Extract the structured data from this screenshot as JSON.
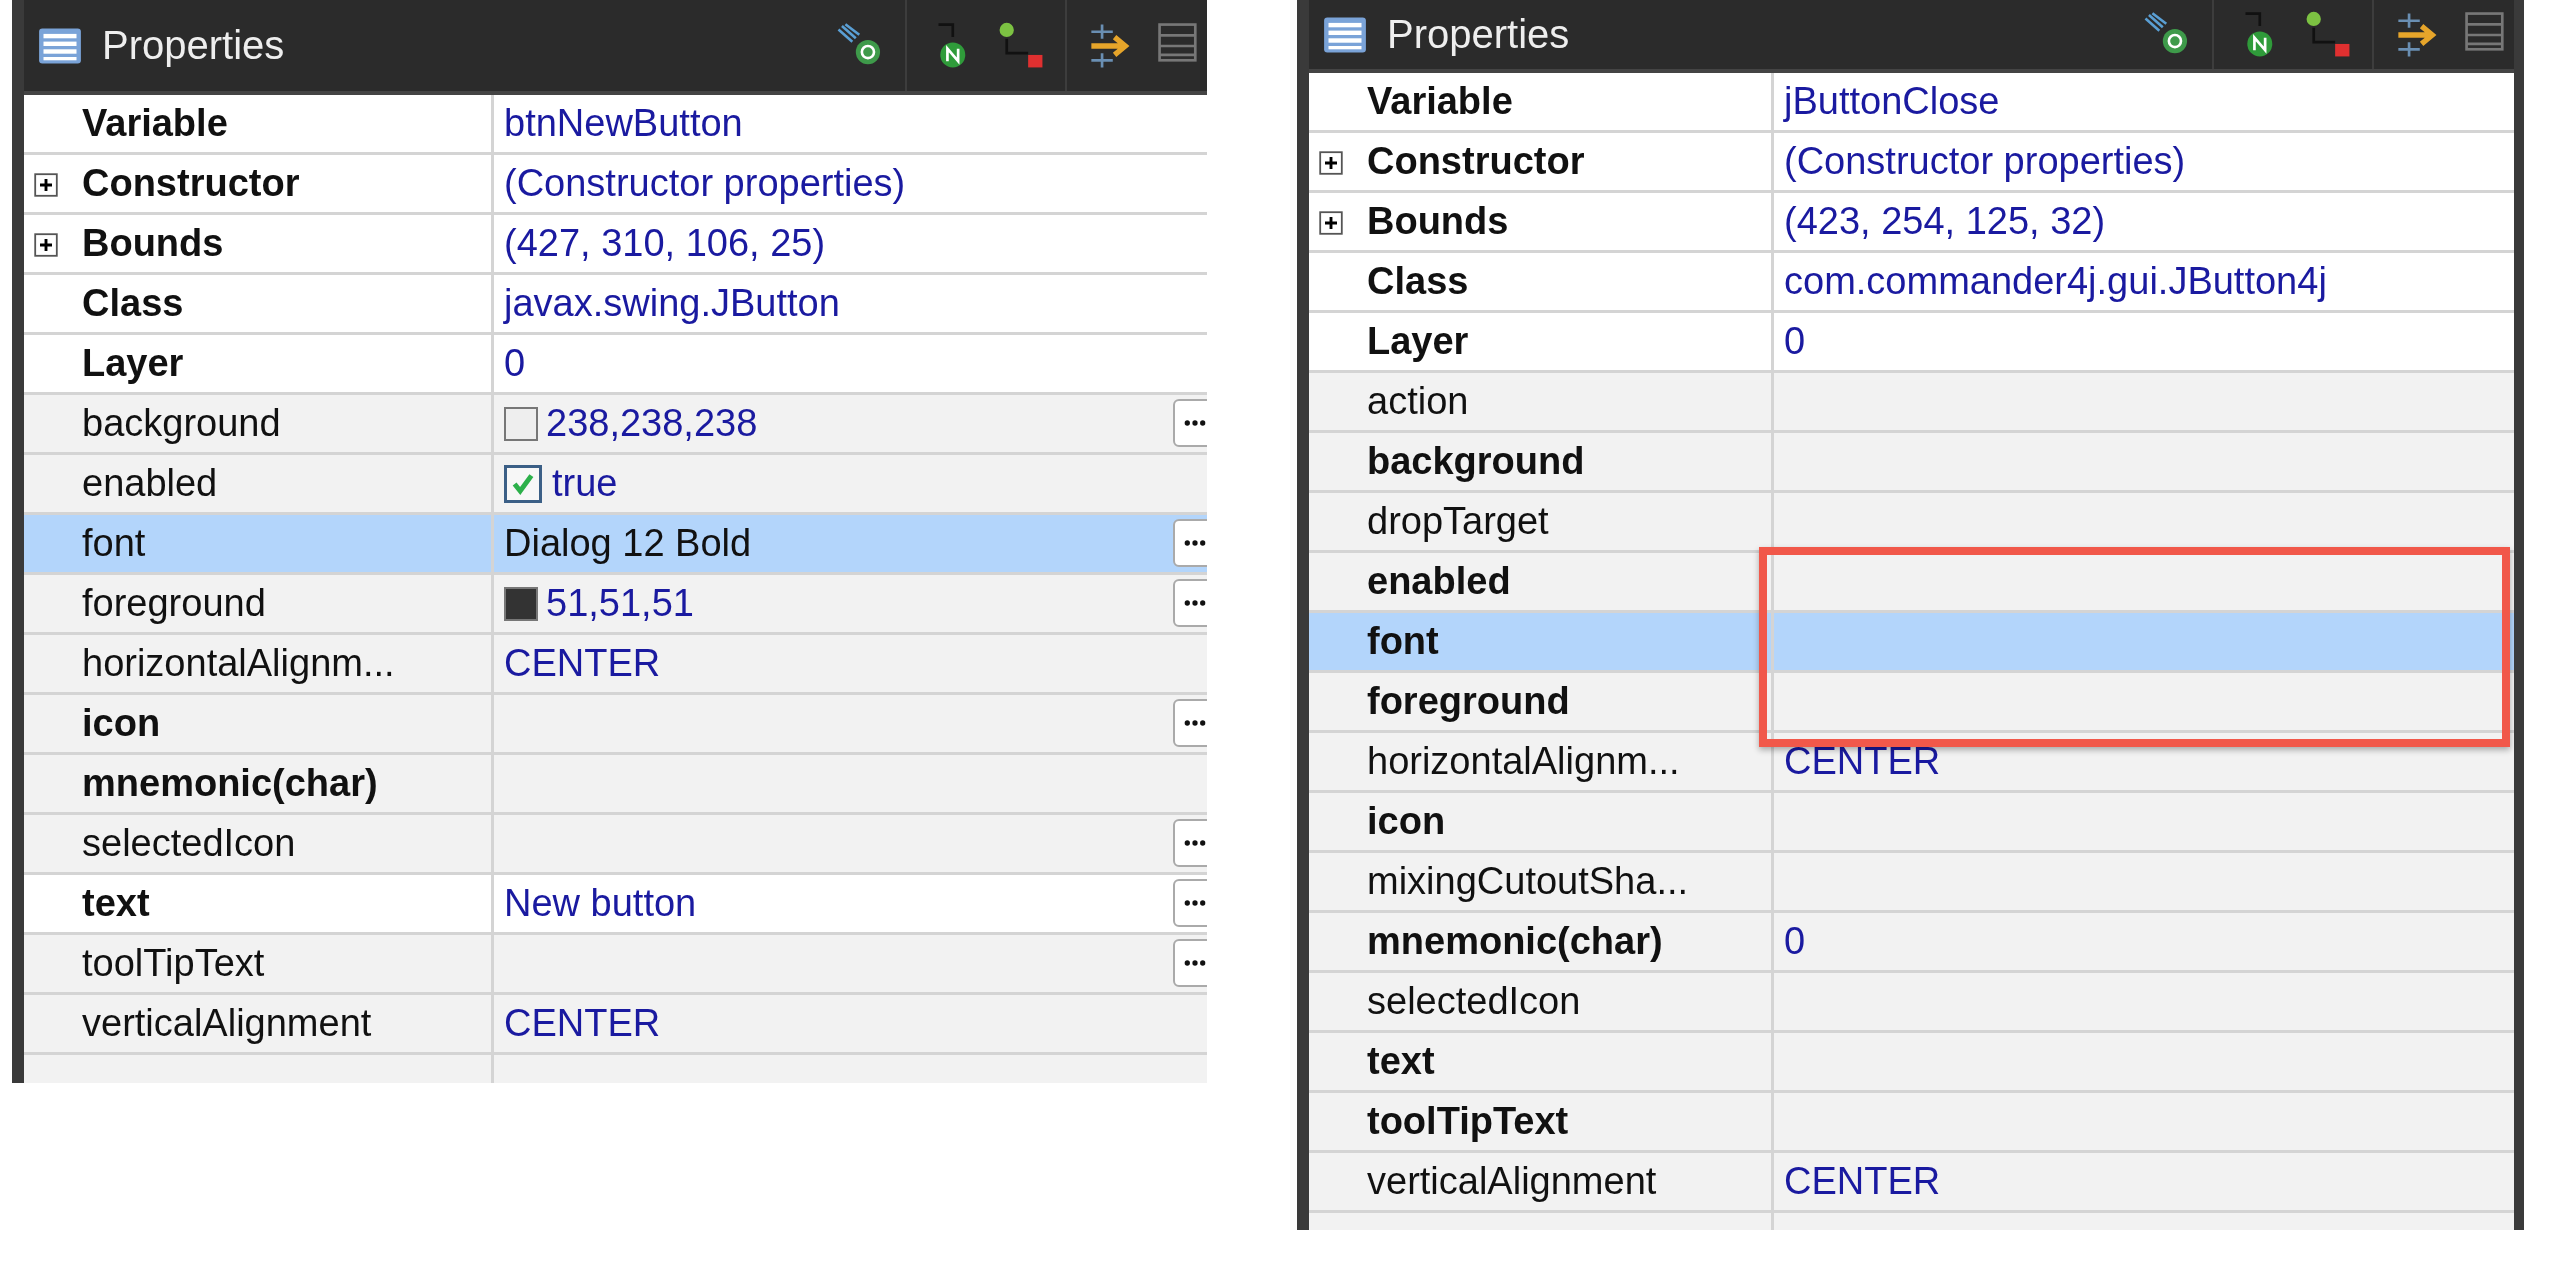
{
  "panels": [
    {
      "title": "Properties",
      "rows": [
        {
          "name": "Variable",
          "bold": true,
          "expandable": false,
          "value": "btnNewButton",
          "kind": "text",
          "has_button": false,
          "selected": false,
          "set": true,
          "boxed": false
        },
        {
          "name": "Constructor",
          "bold": true,
          "expandable": true,
          "value": "(Constructor properties)",
          "kind": "text",
          "has_button": false,
          "selected": false,
          "set": true,
          "boxed": false
        },
        {
          "name": "Bounds",
          "bold": true,
          "expandable": true,
          "value": "(427, 310, 106, 25)",
          "kind": "text",
          "has_button": false,
          "selected": false,
          "set": true,
          "boxed": false
        },
        {
          "name": "Class",
          "bold": true,
          "expandable": false,
          "value": "javax.swing.JButton",
          "kind": "text",
          "has_button": false,
          "selected": false,
          "set": true,
          "boxed": false
        },
        {
          "name": "Layer",
          "bold": true,
          "expandable": false,
          "value": "0",
          "kind": "text",
          "has_button": false,
          "selected": false,
          "set": true,
          "boxed": false
        },
        {
          "name": "background",
          "bold": false,
          "expandable": false,
          "value": "238,238,238",
          "kind": "swatch",
          "color": "#eeeeee",
          "has_button": true,
          "selected": false,
          "set": false,
          "boxed": false
        },
        {
          "name": "enabled",
          "bold": false,
          "expandable": false,
          "value": "true",
          "kind": "checkbox",
          "checked": true,
          "has_button": false,
          "selected": false,
          "set": false,
          "boxed": false
        },
        {
          "name": "font",
          "bold": false,
          "expandable": false,
          "value": "Dialog 12 Bold",
          "kind": "text",
          "has_button": true,
          "selected": true,
          "set": false,
          "boxed": false
        },
        {
          "name": "foreground",
          "bold": false,
          "expandable": false,
          "value": "51,51,51",
          "kind": "swatch",
          "color": "#333333",
          "has_button": true,
          "selected": false,
          "set": false,
          "boxed": false
        },
        {
          "name": "horizontalAlignm...",
          "bold": false,
          "expandable": false,
          "value": "CENTER",
          "kind": "text",
          "has_button": false,
          "selected": false,
          "set": false,
          "boxed": false
        },
        {
          "name": "icon",
          "bold": true,
          "expandable": false,
          "value": "",
          "kind": "text",
          "has_button": true,
          "selected": false,
          "set": false,
          "boxed": false
        },
        {
          "name": "mnemonic(char)",
          "bold": true,
          "expandable": false,
          "value": "",
          "kind": "text",
          "has_button": false,
          "selected": false,
          "set": false,
          "boxed": false
        },
        {
          "name": "selectedIcon",
          "bold": false,
          "expandable": false,
          "value": "",
          "kind": "text",
          "has_button": true,
          "selected": false,
          "set": false,
          "boxed": false
        },
        {
          "name": "text",
          "bold": true,
          "expandable": false,
          "value": "New button",
          "kind": "text",
          "has_button": true,
          "selected": false,
          "set": true,
          "boxed": false
        },
        {
          "name": "toolTipText",
          "bold": false,
          "expandable": false,
          "value": "",
          "kind": "text",
          "has_button": true,
          "selected": false,
          "set": false,
          "boxed": false
        },
        {
          "name": "verticalAlignment",
          "bold": false,
          "expandable": false,
          "value": "CENTER",
          "kind": "text",
          "has_button": false,
          "selected": false,
          "set": false,
          "boxed": false
        }
      ]
    },
    {
      "title": "Properties",
      "rows": [
        {
          "name": "Variable",
          "bold": true,
          "expandable": false,
          "value": "jButtonClose",
          "kind": "text",
          "has_button": false,
          "selected": false,
          "set": true,
          "boxed": false
        },
        {
          "name": "Constructor",
          "bold": true,
          "expandable": true,
          "value": "(Constructor properties)",
          "kind": "text",
          "has_button": false,
          "selected": false,
          "set": true,
          "boxed": false
        },
        {
          "name": "Bounds",
          "bold": true,
          "expandable": true,
          "value": "(423, 254, 125, 32)",
          "kind": "text",
          "has_button": false,
          "selected": false,
          "set": true,
          "boxed": false
        },
        {
          "name": "Class",
          "bold": true,
          "expandable": false,
          "value": "com.commander4j.gui.JButton4j",
          "kind": "text",
          "has_button": false,
          "selected": false,
          "set": true,
          "boxed": false
        },
        {
          "name": "Layer",
          "bold": true,
          "expandable": false,
          "value": "0",
          "kind": "text",
          "has_button": false,
          "selected": false,
          "set": true,
          "boxed": false
        },
        {
          "name": "action",
          "bold": false,
          "expandable": false,
          "value": "",
          "kind": "text",
          "has_button": false,
          "selected": false,
          "set": false,
          "boxed": false
        },
        {
          "name": "background",
          "bold": true,
          "expandable": false,
          "value": "",
          "kind": "text",
          "has_button": false,
          "selected": false,
          "set": false,
          "boxed": false
        },
        {
          "name": "dropTarget",
          "bold": false,
          "expandable": false,
          "value": "",
          "kind": "text",
          "has_button": false,
          "selected": false,
          "set": false,
          "boxed": false
        },
        {
          "name": "enabled",
          "bold": true,
          "expandable": false,
          "value": "",
          "kind": "text",
          "has_button": false,
          "selected": false,
          "set": false,
          "boxed": true
        },
        {
          "name": "font",
          "bold": true,
          "expandable": false,
          "value": "",
          "kind": "text",
          "has_button": false,
          "selected": true,
          "set": false,
          "boxed": true
        },
        {
          "name": "foreground",
          "bold": true,
          "expandable": false,
          "value": "",
          "kind": "text",
          "has_button": false,
          "selected": false,
          "set": false,
          "boxed": true
        },
        {
          "name": "horizontalAlignm...",
          "bold": false,
          "expandable": false,
          "value": "CENTER",
          "kind": "text",
          "has_button": false,
          "selected": false,
          "set": false,
          "boxed": false
        },
        {
          "name": "icon",
          "bold": true,
          "expandable": false,
          "value": "",
          "kind": "text",
          "has_button": false,
          "selected": false,
          "set": false,
          "boxed": false
        },
        {
          "name": "mixingCutoutSha...",
          "bold": false,
          "expandable": false,
          "value": "",
          "kind": "text",
          "has_button": false,
          "selected": false,
          "set": false,
          "boxed": false
        },
        {
          "name": "mnemonic(char)",
          "bold": true,
          "expandable": false,
          "value": "0",
          "kind": "text",
          "has_button": false,
          "selected": false,
          "set": false,
          "boxed": false
        },
        {
          "name": "selectedIcon",
          "bold": false,
          "expandable": false,
          "value": "",
          "kind": "text",
          "has_button": false,
          "selected": false,
          "set": false,
          "boxed": false
        },
        {
          "name": "text",
          "bold": true,
          "expandable": false,
          "value": "",
          "kind": "text",
          "has_button": false,
          "selected": false,
          "set": false,
          "boxed": false
        },
        {
          "name": "toolTipText",
          "bold": true,
          "expandable": false,
          "value": "",
          "kind": "text",
          "has_button": false,
          "selected": false,
          "set": false,
          "boxed": false
        },
        {
          "name": "verticalAlignment",
          "bold": false,
          "expandable": false,
          "value": "CENTER",
          "kind": "text",
          "has_button": false,
          "selected": false,
          "set": false,
          "boxed": false
        }
      ]
    }
  ]
}
